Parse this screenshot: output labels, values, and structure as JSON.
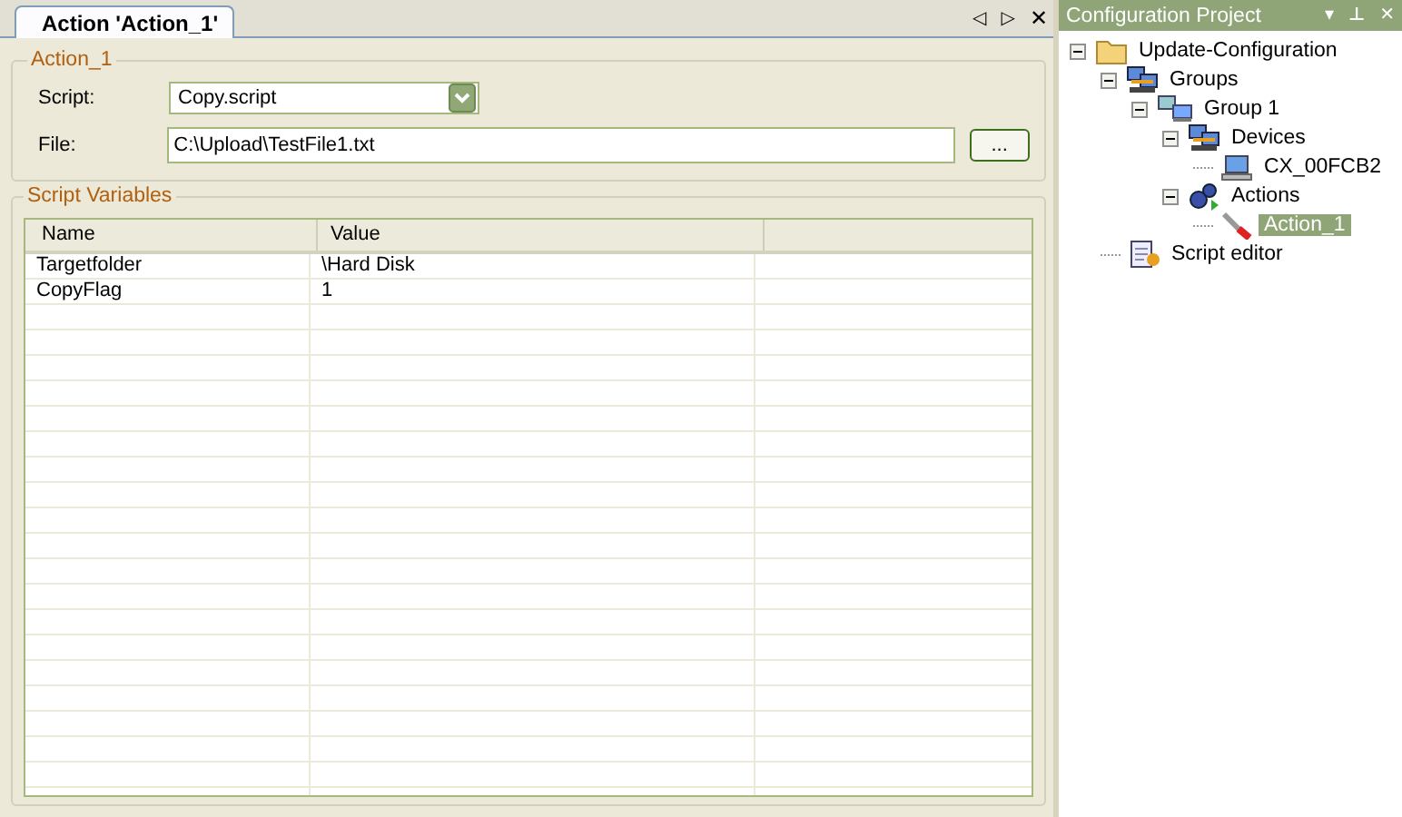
{
  "document_tab": {
    "title": "Action 'Action_1'",
    "selected": true
  },
  "tab_controls": {
    "prev": "◁",
    "next": "▷",
    "close": "✕"
  },
  "action_group": {
    "title": "Action_1",
    "script_label": "Script:",
    "script_value": "Copy.script",
    "file_label": "File:",
    "file_value": "C:\\Upload\\TestFile1.txt",
    "browse_button": "..."
  },
  "variables_group": {
    "title": "Script Variables",
    "columns": [
      "Name",
      "Value"
    ],
    "rows": [
      {
        "name": "Targetfolder",
        "value": "\\Hard Disk"
      },
      {
        "name": "CopyFlag",
        "value": "1"
      }
    ]
  },
  "project_panel": {
    "title": "Configuration Project",
    "controls": {
      "menu": "▾",
      "pin": "⊥",
      "close": "✕"
    },
    "tree": [
      {
        "label": "Update-Configuration",
        "kind": "folder",
        "expanded": true,
        "selected": false,
        "children": [
          {
            "label": "Groups",
            "kind": "groups",
            "expanded": true,
            "selected": false,
            "children": [
              {
                "label": "Group 1",
                "kind": "group",
                "expanded": true,
                "selected": false,
                "children": [
                  {
                    "label": "Devices",
                    "kind": "groups",
                    "expanded": true,
                    "selected": false,
                    "children": [
                      {
                        "label": "CX_00FCB2",
                        "kind": "device",
                        "selected": false
                      }
                    ]
                  },
                  {
                    "label": "Actions",
                    "kind": "gears",
                    "expanded": true,
                    "selected": false,
                    "children": [
                      {
                        "label": "Action_1",
                        "kind": "wrench",
                        "selected": true
                      }
                    ]
                  }
                ]
              }
            ]
          },
          {
            "label": "Script editor",
            "kind": "script",
            "selected": false
          }
        ]
      }
    ]
  }
}
